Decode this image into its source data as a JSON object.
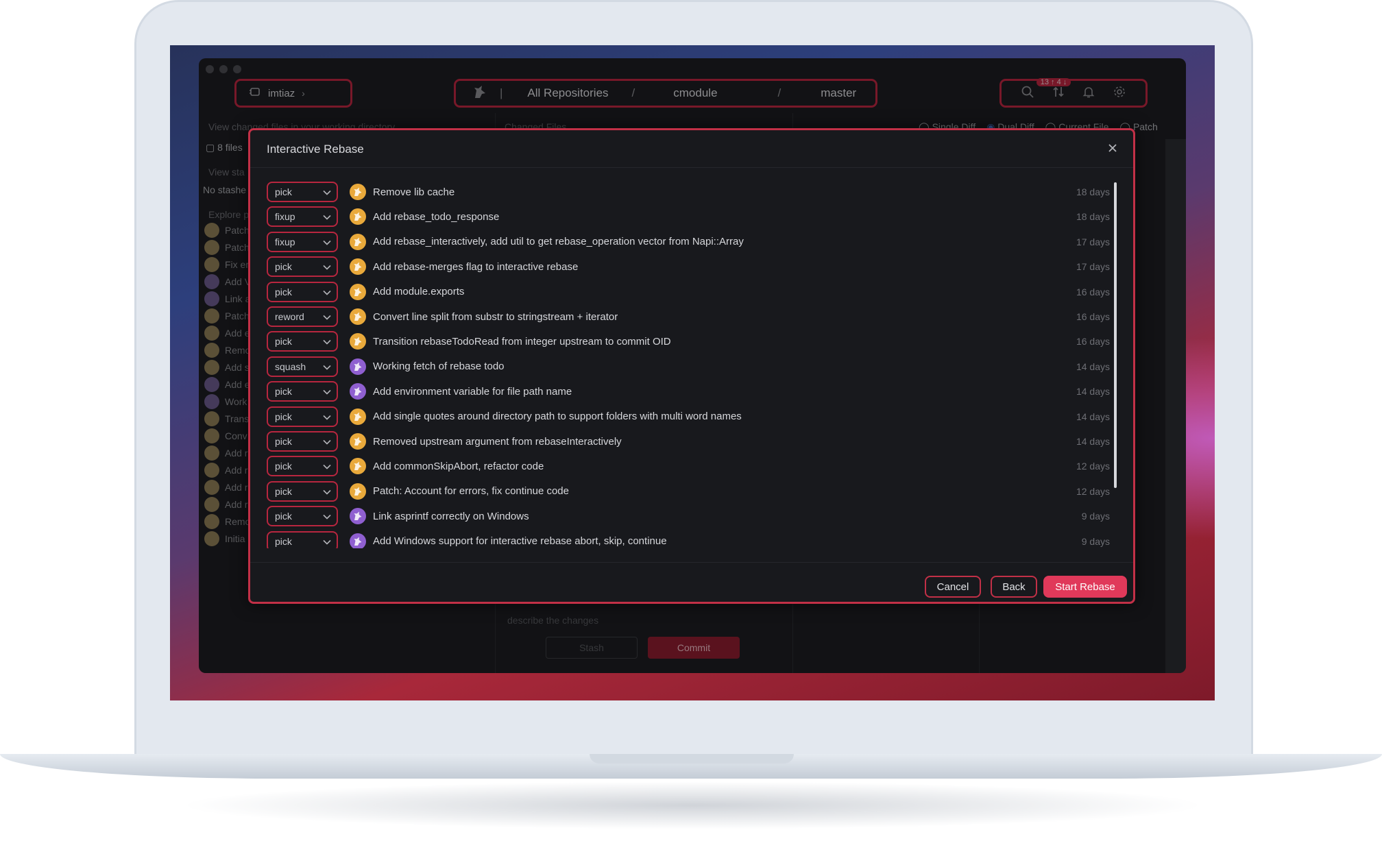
{
  "window": {
    "user": "imtiaz",
    "breadcrumb": [
      "All Repositories",
      "cmodule",
      "master"
    ],
    "sync_badge": "13 ↑ 4 ↓"
  },
  "background_panel": {
    "working_dir_hint": "View changed files in your working directory",
    "changed_files_header": "Changed Files",
    "file_count": "8 files",
    "view_stashes": "View sta",
    "no_stashes": "No stashe",
    "explore": "Explore p",
    "diff_options": [
      "Single Diff",
      "Dual Diff",
      "Current File",
      "Patch"
    ],
    "commit_placeholder": "describe the changes",
    "stash_label": "Stash",
    "commit_label": "Commit",
    "sidebar_items": [
      "Patch",
      "Patch",
      "Fix er",
      "Add V",
      "Link a",
      "Patch",
      "Add e",
      "Remo",
      "Add s",
      "Add e",
      "Work",
      "Trans",
      "Conv",
      "Add r",
      "Add r",
      "Add r",
      "Add r",
      "Remo",
      "Initia"
    ]
  },
  "modal": {
    "title": "Interactive Rebase",
    "cancel_label": "Cancel",
    "back_label": "Back",
    "start_label": "Start Rebase",
    "commits": [
      {
        "action": "pick",
        "message": "Remove lib cache",
        "age": "18 days",
        "avatar": "gold"
      },
      {
        "action": "fixup",
        "message": "Add rebase_todo_response",
        "age": "18 days",
        "avatar": "gold"
      },
      {
        "action": "fixup",
        "message": "Add rebase_interactively, add util to get rebase_operation vector from Napi::Array",
        "age": "17 days",
        "avatar": "gold"
      },
      {
        "action": "pick",
        "message": "Add rebase-merges flag to interactive rebase",
        "age": "17 days",
        "avatar": "gold"
      },
      {
        "action": "pick",
        "message": "Add module.exports",
        "age": "16 days",
        "avatar": "gold"
      },
      {
        "action": "reword",
        "message": "Convert line split from substr to stringstream + iterator",
        "age": "16 days",
        "avatar": "gold"
      },
      {
        "action": "pick",
        "message": "Transition rebaseTodoRead from integer upstream to commit OID",
        "age": "16 days",
        "avatar": "gold"
      },
      {
        "action": "squash",
        "message": "Working fetch of rebase todo",
        "age": "14 days",
        "avatar": "purple"
      },
      {
        "action": "pick",
        "message": "Add environment variable for file path name",
        "age": "14 days",
        "avatar": "purple"
      },
      {
        "action": "pick",
        "message": "Add single quotes around directory path to support folders with multi word names",
        "age": "14 days",
        "avatar": "gold"
      },
      {
        "action": "pick",
        "message": "Removed upstream argument from rebaseInteractively",
        "age": "14 days",
        "avatar": "gold"
      },
      {
        "action": "pick",
        "message": "Add commonSkipAbort, refactor code",
        "age": "12 days",
        "avatar": "gold"
      },
      {
        "action": "pick",
        "message": "Patch: Account for errors, fix continue code",
        "age": "12 days",
        "avatar": "gold"
      },
      {
        "action": "pick",
        "message": "Link asprintf correctly on Windows",
        "age": "9 days",
        "avatar": "purple"
      },
      {
        "action": "pick",
        "message": "Add Windows support for interactive rebase abort, skip, continue",
        "age": "9 days",
        "avatar": "purple"
      }
    ]
  },
  "colors": {
    "accent": "#c23047",
    "primary_button": "#e0395a",
    "avatar_gold": "#e9a93b",
    "avatar_purple": "#8f5fd0"
  }
}
